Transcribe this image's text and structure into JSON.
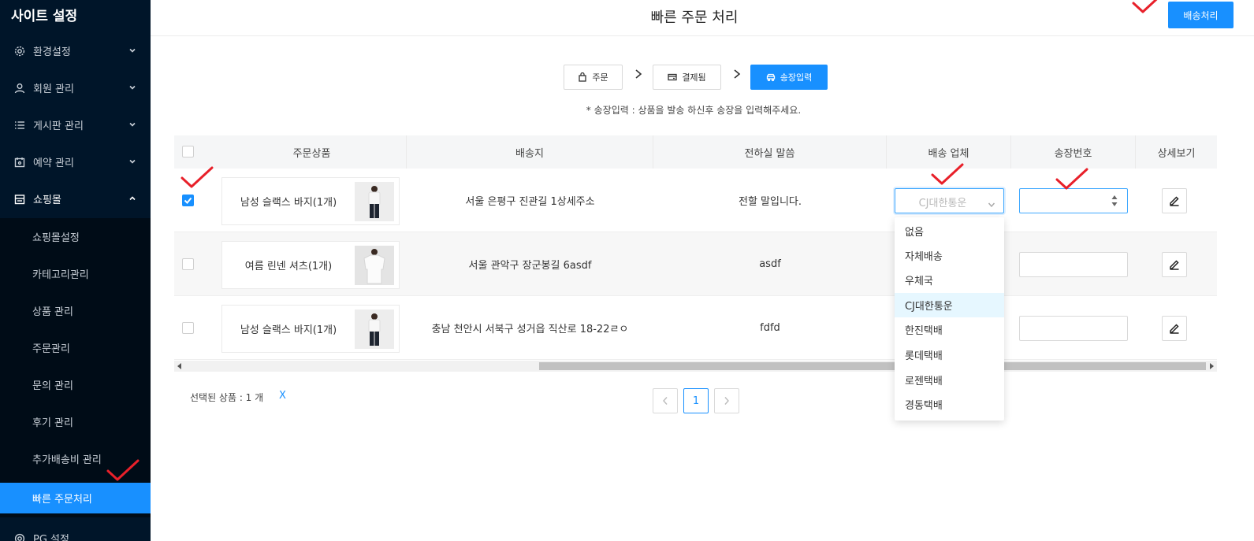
{
  "sidebar": {
    "title": "사이트 설정",
    "menu": [
      {
        "label": "환경설정",
        "icon": "gear-icon"
      },
      {
        "label": "회원 관리",
        "icon": "user-icon"
      },
      {
        "label": "게시판 관리",
        "icon": "list-icon"
      },
      {
        "label": "예약 관리",
        "icon": "calendar-icon"
      },
      {
        "label": "쇼핑몰",
        "icon": "shop-icon"
      }
    ],
    "submenu": [
      "쇼핑몰설정",
      "카테고리관리",
      "상품 관리",
      "주문관리",
      "문의 관리",
      "후기 관리",
      "추가배송비 관리",
      "빠른 주문처리"
    ],
    "next_item": "PG 설정"
  },
  "header": {
    "title": "빠른 주문 처리",
    "ship_button": "배송처리"
  },
  "steps": [
    "주문",
    "결제됨",
    "송장입력"
  ],
  "notice": "* 송장입력 : 상품을 발송 하신후 송장을 입력해주세요.",
  "table": {
    "headers": [
      "주문상품",
      "배송지",
      "전하실 말씀",
      "배송 업체",
      "송장번호",
      "상세보기"
    ],
    "rows": [
      {
        "product": "남성 슬랙스 바지(1개)",
        "address": "서울 은평구 진관길 1상세주소",
        "message": "전할 말입니다.",
        "checked": true
      },
      {
        "product": "여름 린넨 셔츠(1개)",
        "address": "서울 관악구 장군봉길 6asdf",
        "message": "asdf",
        "checked": false
      },
      {
        "product": "남성 슬랙스 바지(1개)",
        "address": "충남 천안시 서북구 성거읍 직산로 18-22ㄹㅇ",
        "message": "fdfd",
        "checked": false
      }
    ],
    "carrier_placeholder": "CJ대한통운"
  },
  "carrier_options": [
    "없음",
    "자체배송",
    "우체국",
    "CJ대한통운",
    "한진택배",
    "롯데택배",
    "로젠택배",
    "경동택배"
  ],
  "carrier_selected": "CJ대한통운",
  "footer": {
    "selected_text": "선택된 상품 : 1 개",
    "clear": "X",
    "page": "1"
  },
  "colors": {
    "sidebar_bg": "#001529",
    "accent": "#1890ff",
    "mark": "#e8202a"
  }
}
